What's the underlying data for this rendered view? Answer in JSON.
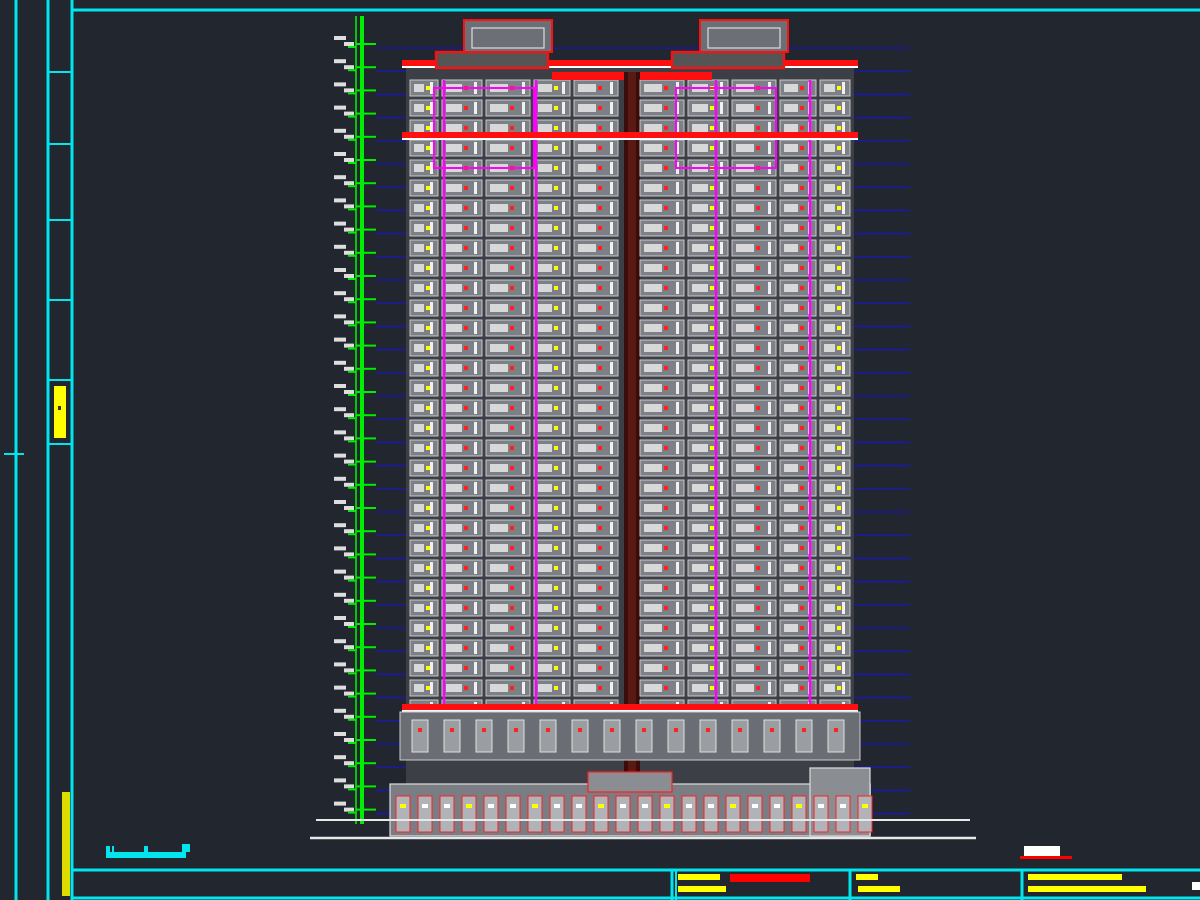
{
  "drawing": {
    "kind": "elevation"
  }
}
